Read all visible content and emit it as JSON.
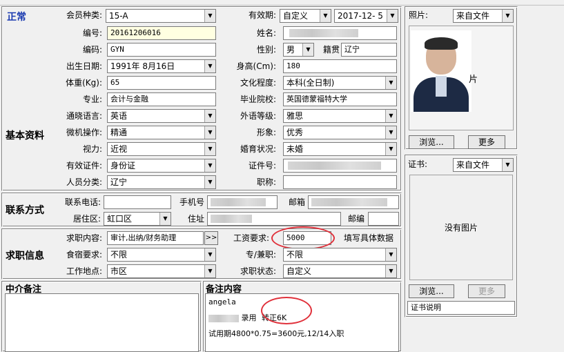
{
  "title_badge": "正常",
  "header": {
    "member_type_label": "会员种类:",
    "member_type_value": "15-A",
    "validity_label": "有效期:",
    "validity_mode": "自定义",
    "validity_date": "2017-12- 5"
  },
  "photo": {
    "label": "照片:",
    "source": "来自文件",
    "side_char": "片",
    "browse_btn": "浏览...",
    "more_btn": "更多"
  },
  "cert": {
    "label": "证书:",
    "source": "来自文件",
    "empty_text": "没有图片",
    "browse_btn": "浏览...",
    "more_btn": "更多",
    "desc": "证书说明"
  },
  "basic": {
    "section_label": "基本资料",
    "number_label": "编号:",
    "number_value": "20161206016",
    "name_label": "姓名:",
    "code_label": "编码:",
    "code_value": "GYN",
    "gender_label": "性别:",
    "gender_value": "男",
    "native_label": "籍贯",
    "native_value": "辽宁",
    "birth_label": "出生日期:",
    "birth_value": "1991年 8月16日",
    "height_label": "身高(Cm):",
    "height_value": "180",
    "weight_label": "体重(Kg):",
    "weight_value": "65",
    "edu_label": "文化程度:",
    "edu_value": "本科(全日制)",
    "major_label": "专业:",
    "major_value": "会计与金融",
    "school_label": "毕业院校:",
    "school_value": "英国德蒙福特大学",
    "lang_label": "通晓语言:",
    "lang_value": "英语",
    "foreign_label": "外语等级:",
    "foreign_value": "雅思",
    "pc_label": "微机操作:",
    "pc_value": "精通",
    "image_label": "形象:",
    "image_value": "优秀",
    "vision_label": "视力:",
    "vision_value": "近视",
    "marital_label": "婚育状况:",
    "marital_value": "未婚",
    "id_type_label": "有效证件:",
    "id_type_value": "身份证",
    "id_no_label": "证件号:",
    "category_label": "人员分类:",
    "category_value": "辽宁",
    "title_label": "职称:"
  },
  "contact": {
    "section_label": "联系方式",
    "phone_label": "联系电话:",
    "mobile_label": "手机号",
    "email_label": "邮箱",
    "district_label": "居住区:",
    "district_value": "虹口区",
    "address_label": "住址",
    "zip_label": "邮编"
  },
  "job": {
    "section_label": "求职信息",
    "content_label": "求职内容:",
    "content_value": "审计,出纳/财务助理",
    "more_btn": ">>",
    "salary_label": "工资要求:",
    "salary_value": "5000",
    "salary_hint": "填写具体数据",
    "lodging_label": "食宿要求:",
    "lodging_value": "不限",
    "parttime_label": "专/兼职:",
    "parttime_value": "不限",
    "place_label": "工作地点:",
    "place_value": "市区",
    "status_label": "求职状态:",
    "status_value": "自定义"
  },
  "notes": {
    "agent_label": "中介备注",
    "remark_label": "备注内容",
    "line1": "angela",
    "line2_mid": "录用",
    "line2_end": "转正6K",
    "line3": "试用期4800*0.75=3600元,12/14入职"
  }
}
